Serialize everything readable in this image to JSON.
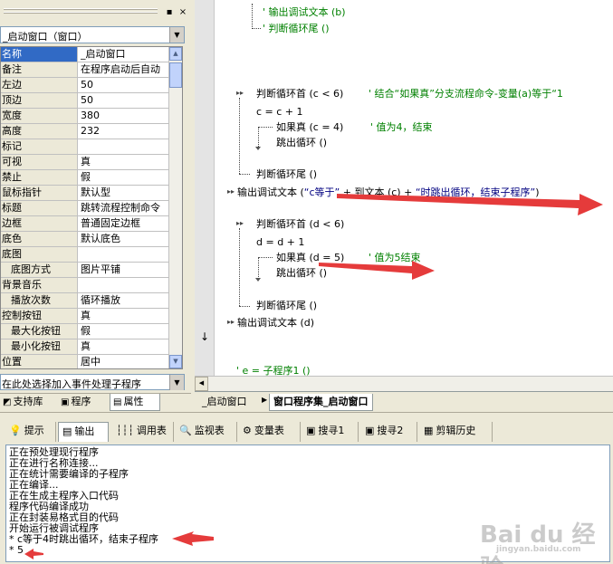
{
  "left_panel": {
    "toolbar": {
      "pin": "▪",
      "close": "×"
    },
    "object_selector": "_启动窗口（窗口）",
    "properties": [
      {
        "name": "名称",
        "value": "_启动窗口",
        "selected": true,
        "indent": false
      },
      {
        "name": "备注",
        "value": "在程序启动后自动",
        "selected": false,
        "indent": false
      },
      {
        "name": "左边",
        "value": "50",
        "selected": false,
        "indent": false
      },
      {
        "name": "顶边",
        "value": "50",
        "selected": false,
        "indent": false
      },
      {
        "name": "宽度",
        "value": "380",
        "selected": false,
        "indent": false
      },
      {
        "name": "高度",
        "value": "232",
        "selected": false,
        "indent": false
      },
      {
        "name": "标记",
        "value": "",
        "selected": false,
        "indent": false
      },
      {
        "name": "可视",
        "value": "真",
        "selected": false,
        "indent": false
      },
      {
        "name": "禁止",
        "value": "假",
        "selected": false,
        "indent": false
      },
      {
        "name": "鼠标指针",
        "value": "默认型",
        "selected": false,
        "indent": false
      },
      {
        "name": "标题",
        "value": "跳转流程控制命令",
        "selected": false,
        "indent": false
      },
      {
        "name": "边框",
        "value": "普通固定边框",
        "selected": false,
        "indent": false
      },
      {
        "name": "底色",
        "value": "默认底色",
        "selected": false,
        "indent": false
      },
      {
        "name": "底图",
        "value": "",
        "selected": false,
        "indent": false
      },
      {
        "name": "底图方式",
        "value": "图片平铺",
        "selected": false,
        "indent": true
      },
      {
        "name": "背景音乐",
        "value": "",
        "selected": false,
        "indent": false
      },
      {
        "name": "播放次数",
        "value": "循环播放",
        "selected": false,
        "indent": true
      },
      {
        "name": "控制按钮",
        "value": "真",
        "selected": false,
        "indent": false
      },
      {
        "name": "最大化按钮",
        "value": "假",
        "selected": false,
        "indent": true
      },
      {
        "name": "最小化按钮",
        "value": "真",
        "selected": false,
        "indent": true
      },
      {
        "name": "位置",
        "value": "居中",
        "selected": false,
        "indent": false
      }
    ],
    "event_selector": "在此处选择加入事件处理子程序",
    "tabs": [
      {
        "label": "支持库",
        "icon": "book-icon"
      },
      {
        "label": "程序",
        "icon": "program-icon"
      },
      {
        "label": "属性",
        "icon": "properties-icon"
      }
    ]
  },
  "editor": {
    "lines": {
      "l1": "' 输出调试文本 (b)",
      "l2": "' 判断循环尾 ()",
      "loop1_head_kw": "判断循环首 (c < 6)",
      "loop1_head_cm": "' 结合“如果真”分支流程命令-变量(a)等于“1",
      "loop1_assign": "c = c + 1",
      "loop1_if": "如果真 (c = 4)",
      "loop1_if_cm": "' 值为4，结束",
      "loop1_break": "跳出循环 ()",
      "loop1_tail": "判断循环尾 ()",
      "debug1_prefix": "输出调试文本 (",
      "debug1_str1": "“c等于”",
      "debug1_mid": " + 到文本 (c) + ",
      "debug1_str2": "“时跳出循环，结束子程序”",
      "debug1_suffix": ")",
      "loop2_head": "判断循环首 (d < 6)",
      "loop2_assign": "d = d + 1",
      "loop2_if": "如果真 (d = 5)",
      "loop2_if_cm": "' 值为5结束",
      "loop2_break": "跳出循环 ()",
      "loop2_tail": "判断循环尾 ()",
      "debug2": "输出调试文本 (d)",
      "last": "' e = 子程序1 ()"
    },
    "tabs": [
      {
        "label": "_启动窗口",
        "active": false
      },
      {
        "label": "窗口程序集_启动窗口",
        "active": true
      }
    ]
  },
  "bottom_panel": {
    "tabs": [
      {
        "label": "提示",
        "icon": "tip-icon"
      },
      {
        "label": "输出",
        "icon": "output-icon"
      },
      {
        "label": "调用表",
        "icon": "callstack-icon"
      },
      {
        "label": "监视表",
        "icon": "watch-icon"
      },
      {
        "label": "变量表",
        "icon": "variables-icon"
      },
      {
        "label": "搜寻1",
        "icon": "search-icon"
      },
      {
        "label": "搜寻2",
        "icon": "search-icon"
      },
      {
        "label": "剪辑历史",
        "icon": "clipboard-icon"
      }
    ],
    "output_lines": [
      "正在预处理现行程序",
      "正在进行名称连接...",
      "正在统计需要编译的子程序",
      "正在编译...",
      "正在生成主程序入口代码",
      "程序代码编译成功",
      "正在封装易格式目的代码",
      "开始运行被调试程序",
      "* c等于4时跳出循环，结束子程序",
      "* 5"
    ]
  },
  "watermark": {
    "logo": "Bai du 经验",
    "url": "jingyan.baidu.com"
  },
  "colors": {
    "selection": "#316ac5",
    "annotation_arrow": "#e53b3b",
    "comment": "#008000",
    "string": "#000080"
  }
}
